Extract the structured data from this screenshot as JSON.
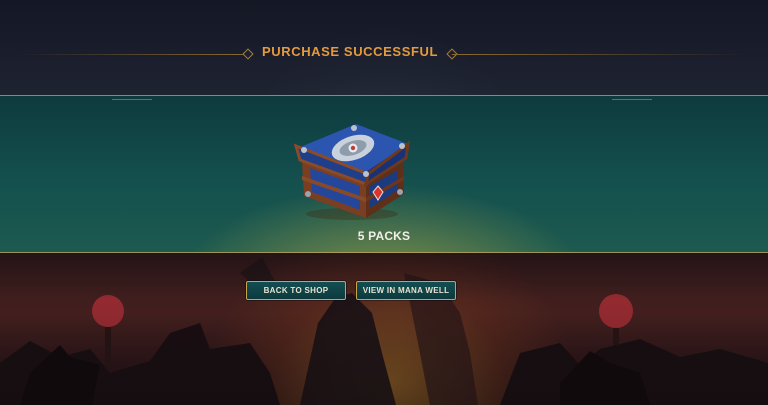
{
  "header": {
    "title": "PURCHASE SUCCESSFUL"
  },
  "reward": {
    "icon": "treasure-chest-icon",
    "label": "5 PACKS"
  },
  "actions": {
    "back_to_shop": "BACK TO SHOP",
    "view_in_mana_well": "VIEW IN MANA WELL"
  },
  "colors": {
    "title": "#e59a3b",
    "button_bg": "#134e52",
    "button_border": "#c9a44f",
    "band_teal": "#14504e"
  }
}
